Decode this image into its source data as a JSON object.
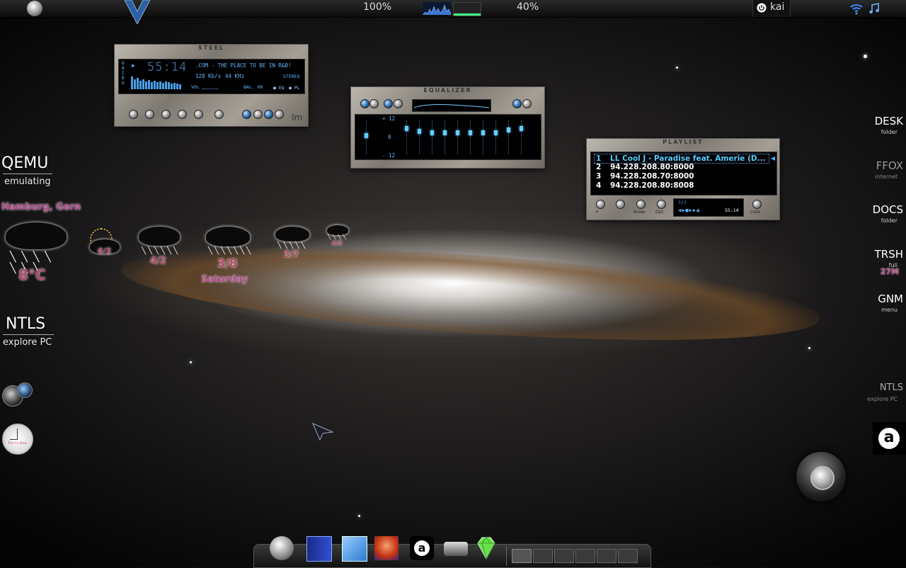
{
  "top_panel": {
    "cpu_percent": "100%",
    "mem_percent": "40%",
    "username": "kai"
  },
  "xmms_player": {
    "skin_title": "STEEL",
    "time": "55:14",
    "stream_title": ".COM - THE PLACE TO BE IN R&B!",
    "kbps": "128 Kb/s",
    "khz": "44 KHz",
    "stereo": "STEREO",
    "vol_label": "VOL",
    "bal_label": "BAL. 00",
    "eq_toggle": "EQ",
    "pl_toggle": "PL"
  },
  "equalizer": {
    "title": "EQUALIZER",
    "plus_label": "+ 12",
    "zero_label": "0",
    "minus_label": "- 12",
    "preamp_level": 0.55,
    "band_levels": [
      0.8,
      0.7,
      0.65,
      0.65,
      0.65,
      0.65,
      0.65,
      0.65,
      0.75,
      0.8
    ]
  },
  "playlist": {
    "title": "PLAYLIST",
    "items": [
      {
        "num": "1",
        "title": "LL Cool J - Paradise feat. Amerie (D..."
      },
      {
        "num": "2",
        "title": "94.228.208.80:8000"
      },
      {
        "num": "3",
        "title": "94.228.208.70:8000"
      },
      {
        "num": "4",
        "title": "94.228.208.80:8008"
      }
    ],
    "buttons": [
      "+",
      "-",
      "Ausw.",
      "Opt.",
      "Liste"
    ],
    "mini_display": "?/?",
    "mini_time": "55:14"
  },
  "left_widgets": {
    "qemu_title": "QEMU",
    "qemu_sub": "emulating",
    "weather_location": "Hamburg, Gern",
    "current_temp": "8°C",
    "forecast": [
      {
        "temp": "6/2",
        "day": ""
      },
      {
        "temp": "4/2",
        "day": ""
      },
      {
        "temp": "3/8",
        "day": "Saturday"
      },
      {
        "temp": "3/7",
        "day": ""
      },
      {
        "temp": "4/8",
        "day": ""
      }
    ],
    "ntls_title": "NTLS",
    "ntls_sub": "explore PC"
  },
  "right_icons": [
    {
      "label": "DESK",
      "sub": "folder"
    },
    {
      "label": "FFOX",
      "sub": "internet"
    },
    {
      "label": "DOCS",
      "sub": "folder"
    },
    {
      "label": "TRSH",
      "sub": "full",
      "extra": "27M"
    },
    {
      "label": "GNM",
      "sub": "menu"
    },
    {
      "label": "NTLS",
      "sub": "explore PC"
    }
  ],
  "clock_brand": "The Ck Bear"
}
